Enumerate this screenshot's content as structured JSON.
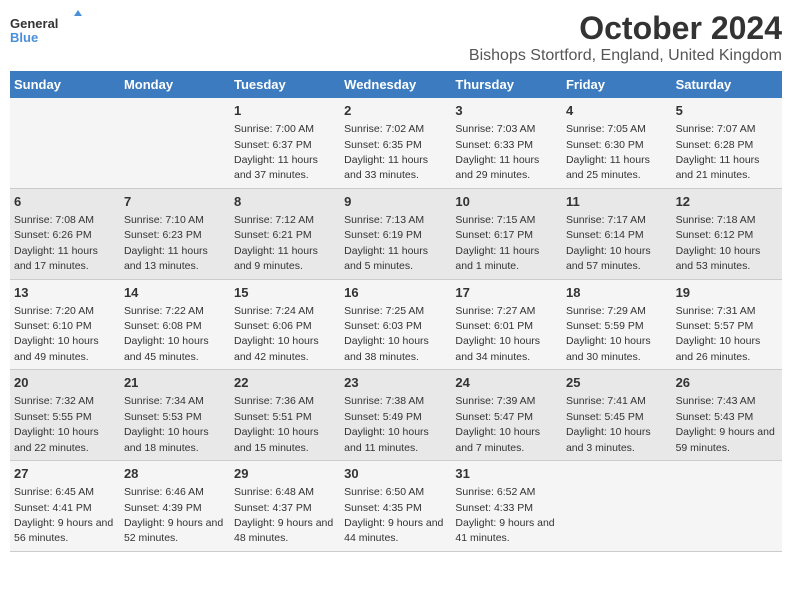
{
  "logo": {
    "general": "General",
    "blue": "Blue"
  },
  "title": "October 2024",
  "subtitle": "Bishops Stortford, England, United Kingdom",
  "weekdays": [
    "Sunday",
    "Monday",
    "Tuesday",
    "Wednesday",
    "Thursday",
    "Friday",
    "Saturday"
  ],
  "weeks": [
    [
      null,
      null,
      {
        "day": 1,
        "sunrise": "7:00 AM",
        "sunset": "6:37 PM",
        "daylight": "11 hours and 37 minutes."
      },
      {
        "day": 2,
        "sunrise": "7:02 AM",
        "sunset": "6:35 PM",
        "daylight": "11 hours and 33 minutes."
      },
      {
        "day": 3,
        "sunrise": "7:03 AM",
        "sunset": "6:33 PM",
        "daylight": "11 hours and 29 minutes."
      },
      {
        "day": 4,
        "sunrise": "7:05 AM",
        "sunset": "6:30 PM",
        "daylight": "11 hours and 25 minutes."
      },
      {
        "day": 5,
        "sunrise": "7:07 AM",
        "sunset": "6:28 PM",
        "daylight": "11 hours and 21 minutes."
      }
    ],
    [
      {
        "day": 6,
        "sunrise": "7:08 AM",
        "sunset": "6:26 PM",
        "daylight": "11 hours and 17 minutes."
      },
      {
        "day": 7,
        "sunrise": "7:10 AM",
        "sunset": "6:23 PM",
        "daylight": "11 hours and 13 minutes."
      },
      {
        "day": 8,
        "sunrise": "7:12 AM",
        "sunset": "6:21 PM",
        "daylight": "11 hours and 9 minutes."
      },
      {
        "day": 9,
        "sunrise": "7:13 AM",
        "sunset": "6:19 PM",
        "daylight": "11 hours and 5 minutes."
      },
      {
        "day": 10,
        "sunrise": "7:15 AM",
        "sunset": "6:17 PM",
        "daylight": "11 hours and 1 minute."
      },
      {
        "day": 11,
        "sunrise": "7:17 AM",
        "sunset": "6:14 PM",
        "daylight": "10 hours and 57 minutes."
      },
      {
        "day": 12,
        "sunrise": "7:18 AM",
        "sunset": "6:12 PM",
        "daylight": "10 hours and 53 minutes."
      }
    ],
    [
      {
        "day": 13,
        "sunrise": "7:20 AM",
        "sunset": "6:10 PM",
        "daylight": "10 hours and 49 minutes."
      },
      {
        "day": 14,
        "sunrise": "7:22 AM",
        "sunset": "6:08 PM",
        "daylight": "10 hours and 45 minutes."
      },
      {
        "day": 15,
        "sunrise": "7:24 AM",
        "sunset": "6:06 PM",
        "daylight": "10 hours and 42 minutes."
      },
      {
        "day": 16,
        "sunrise": "7:25 AM",
        "sunset": "6:03 PM",
        "daylight": "10 hours and 38 minutes."
      },
      {
        "day": 17,
        "sunrise": "7:27 AM",
        "sunset": "6:01 PM",
        "daylight": "10 hours and 34 minutes."
      },
      {
        "day": 18,
        "sunrise": "7:29 AM",
        "sunset": "5:59 PM",
        "daylight": "10 hours and 30 minutes."
      },
      {
        "day": 19,
        "sunrise": "7:31 AM",
        "sunset": "5:57 PM",
        "daylight": "10 hours and 26 minutes."
      }
    ],
    [
      {
        "day": 20,
        "sunrise": "7:32 AM",
        "sunset": "5:55 PM",
        "daylight": "10 hours and 22 minutes."
      },
      {
        "day": 21,
        "sunrise": "7:34 AM",
        "sunset": "5:53 PM",
        "daylight": "10 hours and 18 minutes."
      },
      {
        "day": 22,
        "sunrise": "7:36 AM",
        "sunset": "5:51 PM",
        "daylight": "10 hours and 15 minutes."
      },
      {
        "day": 23,
        "sunrise": "7:38 AM",
        "sunset": "5:49 PM",
        "daylight": "10 hours and 11 minutes."
      },
      {
        "day": 24,
        "sunrise": "7:39 AM",
        "sunset": "5:47 PM",
        "daylight": "10 hours and 7 minutes."
      },
      {
        "day": 25,
        "sunrise": "7:41 AM",
        "sunset": "5:45 PM",
        "daylight": "10 hours and 3 minutes."
      },
      {
        "day": 26,
        "sunrise": "7:43 AM",
        "sunset": "5:43 PM",
        "daylight": "9 hours and 59 minutes."
      }
    ],
    [
      {
        "day": 27,
        "sunrise": "6:45 AM",
        "sunset": "4:41 PM",
        "daylight": "9 hours and 56 minutes."
      },
      {
        "day": 28,
        "sunrise": "6:46 AM",
        "sunset": "4:39 PM",
        "daylight": "9 hours and 52 minutes."
      },
      {
        "day": 29,
        "sunrise": "6:48 AM",
        "sunset": "4:37 PM",
        "daylight": "9 hours and 48 minutes."
      },
      {
        "day": 30,
        "sunrise": "6:50 AM",
        "sunset": "4:35 PM",
        "daylight": "9 hours and 44 minutes."
      },
      {
        "day": 31,
        "sunrise": "6:52 AM",
        "sunset": "4:33 PM",
        "daylight": "9 hours and 41 minutes."
      },
      null,
      null
    ]
  ],
  "labels": {
    "sunrise": "Sunrise:",
    "sunset": "Sunset:",
    "daylight": "Daylight:"
  }
}
